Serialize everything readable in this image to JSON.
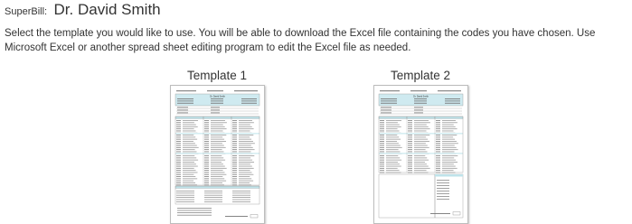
{
  "header": {
    "label": "SuperBill:",
    "doctor_name": "Dr. David Smith"
  },
  "instructions": "Select the template you would like to use. You will be able to download the Excel file containing the codes you have chosen. Use Microsoft Excel or another spread sheet editing program to edit the Excel file as needed.",
  "templates": [
    {
      "title": "Template 1",
      "preview_doctor": "Dr. David Smith",
      "header_tint": "#cfeaf0"
    },
    {
      "title": "Template 2",
      "preview_doctor": "Dr. David Smith",
      "header_tint": "#cfeaf0"
    }
  ]
}
